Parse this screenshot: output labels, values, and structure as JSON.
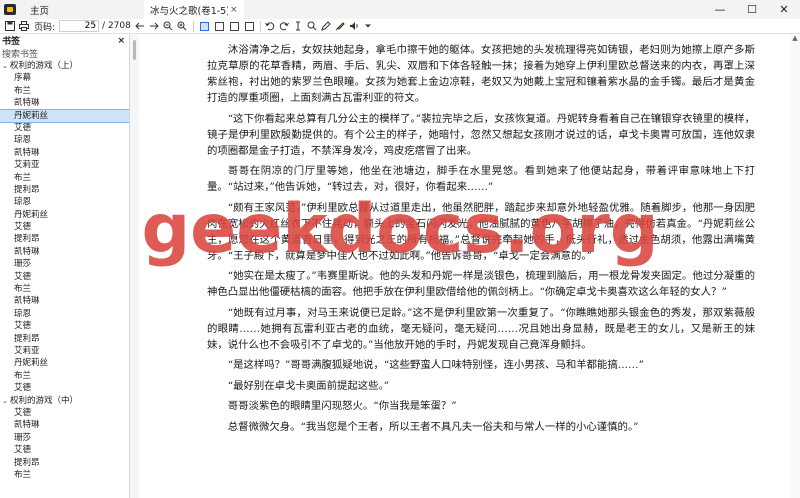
{
  "titlebar": {
    "home_tab": "主页",
    "doc_tab": "冰与火之歌(卷1-5)权力的...",
    "close_glyph": "×",
    "minimize_glyph": "—",
    "maximize_glyph": "☐",
    "close_window_glyph": "✕"
  },
  "toolbar": {
    "page_label": "页码:",
    "page_value": "25",
    "page_total": "/ 2708"
  },
  "sidebar": {
    "title": "书签",
    "close_glyph": "×",
    "search_placeholder": "搜索书签",
    "items": [
      {
        "label": "权利的游戏（上）",
        "level": 0
      },
      {
        "label": "序幕",
        "level": 1
      },
      {
        "label": "布兰",
        "level": 1
      },
      {
        "label": "凯特琳",
        "level": 1
      },
      {
        "label": "丹妮莉丝",
        "level": 1,
        "selected": true
      },
      {
        "label": "艾德",
        "level": 1
      },
      {
        "label": "琼恩",
        "level": 1
      },
      {
        "label": "凯特琳",
        "level": 1
      },
      {
        "label": "艾莉亚",
        "level": 1
      },
      {
        "label": "布兰",
        "level": 1
      },
      {
        "label": "提利昂",
        "level": 1
      },
      {
        "label": "琼恩",
        "level": 1
      },
      {
        "label": "丹妮莉丝",
        "level": 1
      },
      {
        "label": "艾德",
        "level": 1
      },
      {
        "label": "提利昂",
        "level": 1
      },
      {
        "label": "凯特琳",
        "level": 1
      },
      {
        "label": "珊莎",
        "level": 1
      },
      {
        "label": "艾德",
        "level": 1
      },
      {
        "label": "布兰",
        "level": 1
      },
      {
        "label": "凯特琳",
        "level": 1
      },
      {
        "label": "琼恩",
        "level": 1
      },
      {
        "label": "艾德",
        "level": 1
      },
      {
        "label": "提利昂",
        "level": 1
      },
      {
        "label": "艾莉亚",
        "level": 1
      },
      {
        "label": "丹妮莉丝",
        "level": 1
      },
      {
        "label": "布兰",
        "level": 1
      },
      {
        "label": "艾德",
        "level": 1
      },
      {
        "label": "权利的游戏（中）",
        "level": 0
      },
      {
        "label": "艾德",
        "level": 1
      },
      {
        "label": "凯特琳",
        "level": 1
      },
      {
        "label": "珊莎",
        "level": 1
      },
      {
        "label": "艾德",
        "level": 1
      },
      {
        "label": "提利昂",
        "level": 1
      },
      {
        "label": "布兰",
        "level": 1
      }
    ]
  },
  "document": {
    "paragraphs": [
      "沐浴清净之后，女奴扶她起身，拿毛巾擦干她的躯体。女孩把她的头发梳理得亮如铸银，老妇则为她擦上原产多斯拉克草原的花草香精，两眉、手后、乳尖、双唇和下体各轻触一抹；接着为她穿上伊利里欧总督送来的内衣，再罩上深紫丝袍，衬出她的紫罗兰色眼瞳。女孩为她套上金边凉鞋，老奴又为她戴上宝冠和镶着紫水晶的金手镯。最后才是黄金打造的厚重项圈，上面刻满古瓦雷利亚的符文。",
      "“这下你看起来总算有几分公主的模样了。”裴拉完毕之后，女孩恢复道。丹妮转身看着自己在镶银穿衣镜里的模样，镜子是伊利里欧殷勤提供的。有个公主的样子，她暗忖，忽然又想起女孩刚才说过的话，卓戈卡奥胃可放国，连他奴隶的项圈都是金子打造，不禁浑身发冷，鸡皮疙瘩冒了出来。",
      "哥哥在阴凉的门厅里等她，他坐在池塘边，脚手在水里晃悠。看到她来了他便站起身，带着评审意味地上下打量。“站过来，”他告诉她，“转过去，对，很好，你看起来……”",
      "“颇有王家风范，”伊利里欧总督从过道里走出，他虽然肥胖，踏起步来却意外地轻盈优雅。随着脚步，他那一身因肥肉在宽松的火红丝衣下不住晃动，额头上的宝石闪闪发光，他油腻腻的黄色八字胡擦了油，亮得仿若真金。“丹妮莉丝公主，愿您在这个黄道吉日里，得到光之王的所有祝福。”总督说完牵起她的手，低头行礼，透过金色胡须，他露出满嘴黄牙。“王子殿下，就算是梦中佳人也不过如此啊。”他告诉哥哥，“卓戈一定会满意的。”",
      "“她实在是太瘦了。”韦赛里斯说。他的头发和丹妮一样是淡银色，梳理到脑后，用一根龙骨发夹固定。他过分凝重的神色凸显出他僵硬枯槁的面容。他把手放在伊利里欧借给他的佩剑柄上。“你确定卓戈卡奥喜欢这么年轻的女人？”",
      "“她既有过月事，对马王来说便已足龄。”这不是伊利里欧第一次重复了。“你瞧瞧她那头银金色的秀发，那双紫薇般的眼睛……她拥有瓦雷利亚古老的血统，毫无疑问，毫无疑问……况且她出身显赫，既是老王的女儿，又是新王的妹妹，说什么也不会吸引不了卓戈的。”当他放开她的手时，丹妮发现自己竟浑身颤抖。",
      "“是这样吗？”哥哥满腹狐疑地说，“这些野蛮人口味特别怪，连小男孩、马和羊都能搞……”",
      "“最好别在卓戈卡奥面前提起这些。”",
      "哥哥淡紫色的眼睛里闪现怒火。“你当我是笨蛋？”",
      "总督微微欠身。“我当您是个王者，所以王者不具凡夫一俗夫和与常人一样的小心谨慎的。”"
    ]
  },
  "watermark": {
    "text": "geekdocs.org",
    "color": "#d9453d"
  },
  "colors": {
    "selection_bg": "#cde3f8",
    "app_logo": "#f2c200"
  }
}
